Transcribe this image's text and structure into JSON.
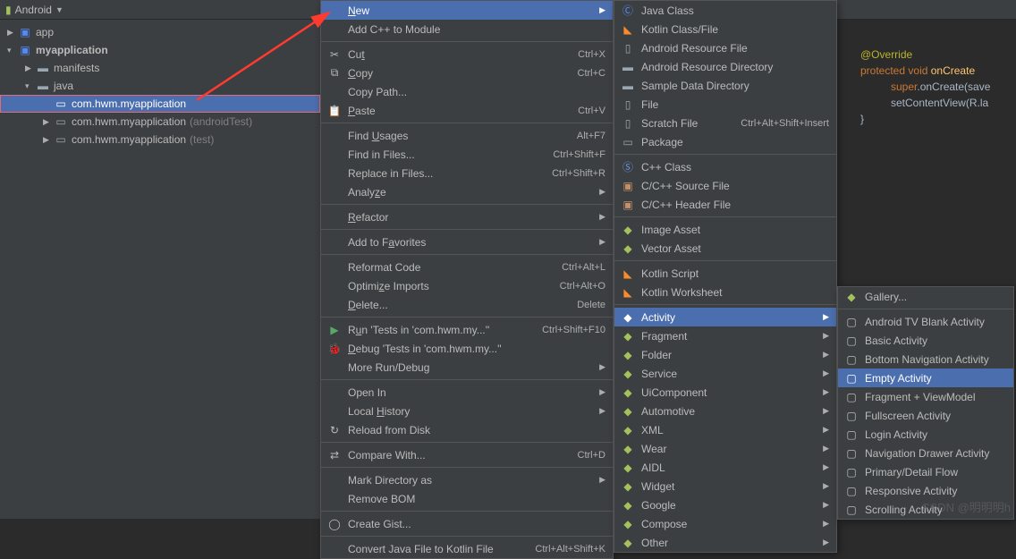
{
  "toolbar": {
    "title": "Android"
  },
  "tree": {
    "app": "app",
    "myapp": "myapplication",
    "manifests": "manifests",
    "java": "java",
    "pkg1": "com.hwm.myapplication",
    "pkg2": "com.hwm.myapplication",
    "pkg2_suffix": "(androidTest)",
    "pkg3": "com.hwm.myapplication",
    "pkg3_suffix": "(test)"
  },
  "ctx": {
    "new": "New",
    "add_cpp": "Add C++ to Module",
    "cut": "Cut",
    "cut_k": "Ctrl+X",
    "copy": "Copy",
    "copy_k": "Ctrl+C",
    "copy_path": "Copy Path...",
    "paste": "Paste",
    "paste_k": "Ctrl+V",
    "find_usages": "Find Usages",
    "find_usages_k": "Alt+F7",
    "find_files": "Find in Files...",
    "find_files_k": "Ctrl+Shift+F",
    "replace_files": "Replace in Files...",
    "replace_files_k": "Ctrl+Shift+R",
    "analyze": "Analyze",
    "refactor": "Refactor",
    "favorites": "Add to Favorites",
    "reformat": "Reformat Code",
    "reformat_k": "Ctrl+Alt+L",
    "optimize": "Optimize Imports",
    "optimize_k": "Ctrl+Alt+O",
    "delete": "Delete...",
    "delete_k": "Delete",
    "run": "Run 'Tests in 'com.hwm.my...''",
    "run_k": "Ctrl+Shift+F10",
    "debug": "Debug 'Tests in 'com.hwm.my...''",
    "more_run": "More Run/Debug",
    "open_in": "Open In",
    "local_hist": "Local History",
    "reload": "Reload from Disk",
    "compare": "Compare With...",
    "compare_k": "Ctrl+D",
    "mark_dir": "Mark Directory as",
    "remove_bom": "Remove BOM",
    "create_gist": "Create Gist...",
    "convert_kt": "Convert Java File to Kotlin File",
    "convert_kt_k": "Ctrl+Alt+Shift+K"
  },
  "newmenu": {
    "java_class": "Java Class",
    "kotlin_class": "Kotlin Class/File",
    "resource_file": "Android Resource File",
    "resource_dir": "Android Resource Directory",
    "sample_dir": "Sample Data Directory",
    "file": "File",
    "scratch": "Scratch File",
    "scratch_k": "Ctrl+Alt+Shift+Insert",
    "package": "Package",
    "cpp_class": "C++ Class",
    "cpp_source": "C/C++ Source File",
    "cpp_header": "C/C++ Header File",
    "image_asset": "Image Asset",
    "vector_asset": "Vector Asset",
    "kotlin_script": "Kotlin Script",
    "kotlin_ws": "Kotlin Worksheet",
    "activity": "Activity",
    "fragment": "Fragment",
    "folder": "Folder",
    "service": "Service",
    "uicomponent": "UiComponent",
    "automotive": "Automotive",
    "xml": "XML",
    "wear": "Wear",
    "aidl": "AIDL",
    "widget": "Widget",
    "google": "Google",
    "compose": "Compose",
    "other": "Other"
  },
  "actmenu": {
    "gallery": "Gallery...",
    "tv_blank": "Android TV Blank Activity",
    "basic": "Basic Activity",
    "bottom_nav": "Bottom Navigation Activity",
    "empty": "Empty Activity",
    "frag_vm": "Fragment + ViewModel",
    "fullscreen": "Fullscreen Activity",
    "login": "Login Activity",
    "nav_drawer": "Navigation Drawer Activity",
    "primary_detail": "Primary/Detail Flow",
    "responsive": "Responsive Activity",
    "scrolling": "Scrolling Activity"
  },
  "code": {
    "l1": "@Override",
    "l2a": "protected",
    "l2b": "void",
    "l2c": "onCreate",
    "l3a": "super",
    "l3b": ".onCreate(save",
    "l4": "setContentView(R.la",
    "l5": "}"
  },
  "watermark": "CSDN @明明明h"
}
